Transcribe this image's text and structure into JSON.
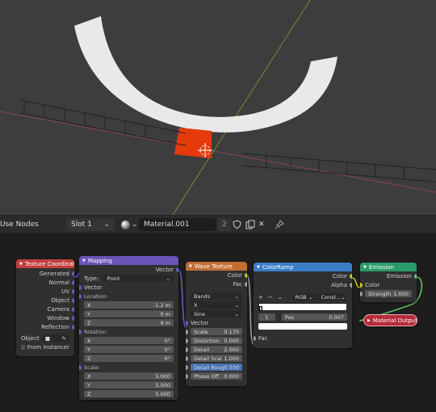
{
  "header": {
    "use_nodes_label": "Use Nodes",
    "slot_label": "Slot 1",
    "material_name": "Material.001",
    "user_count": "2"
  },
  "nodes": {
    "texcoord": {
      "title": "Texture Coordinate",
      "outputs": [
        "Generated",
        "Normal",
        "UV",
        "Object",
        "Camera",
        "Window",
        "Reflection"
      ],
      "object_label": "Object",
      "from_instancer": "From Instancer"
    },
    "mapping": {
      "title": "Mapping",
      "out_vector": "Vector",
      "type_label": "Type:",
      "type_value": "Point",
      "in_vector": "Vector",
      "location_label": "Location:",
      "location": [
        {
          "axis": "X",
          "value": "-1.2 m"
        },
        {
          "axis": "Y",
          "value": "0 m"
        },
        {
          "axis": "Z",
          "value": "9 m"
        }
      ],
      "rotation_label": "Rotation:",
      "rotation": [
        {
          "axis": "X",
          "value": "0°"
        },
        {
          "axis": "Y",
          "value": "0°"
        },
        {
          "axis": "Z",
          "value": "0°"
        }
      ],
      "scale_label": "Scale:",
      "scale": [
        {
          "axis": "X",
          "value": "5.000"
        },
        {
          "axis": "Y",
          "value": "5.000"
        },
        {
          "axis": "Z",
          "value": "5.000"
        }
      ]
    },
    "wave": {
      "title": "Wave Texture",
      "out_color": "Color",
      "out_fac": "Fac",
      "wave_type": "Bands",
      "direction": "X",
      "profile": "Sine",
      "in_vector": "Vector",
      "params": [
        {
          "label": "Scale",
          "value": "0.170"
        },
        {
          "label": "Distortion",
          "value": "0.000"
        },
        {
          "label": "Detail",
          "value": "2.000"
        },
        {
          "label": "Detail Scal",
          "value": "1.000"
        },
        {
          "label": "Detail Roug",
          "value": "0.500"
        },
        {
          "label": "Phase Off",
          "value": "0.000"
        }
      ]
    },
    "colorramp": {
      "title": "ColorRamp",
      "out_color": "Color",
      "out_alpha": "Alpha",
      "mode": "RGB",
      "interp": "Const...",
      "stop_index": "1",
      "pos_label": "Pos",
      "pos_value": "0.007",
      "in_fac": "Fac"
    },
    "emission": {
      "title": "Emission",
      "out_emission": "Emission",
      "in_color": "Color",
      "strength_label": "Strength",
      "strength_value": "1.000"
    },
    "output": {
      "title": "Material Output"
    }
  },
  "colors": {
    "texcoord_header": "#c23f3f",
    "mapping_header": "#6a55b8",
    "wave_header": "#c26e33",
    "colorramp_header": "#3b7dc7",
    "emission_header": "#2b9a6b",
    "output_header": "#b52b3a",
    "ring": "#e9e9e9",
    "ring_highlight": "#e53b0c"
  }
}
